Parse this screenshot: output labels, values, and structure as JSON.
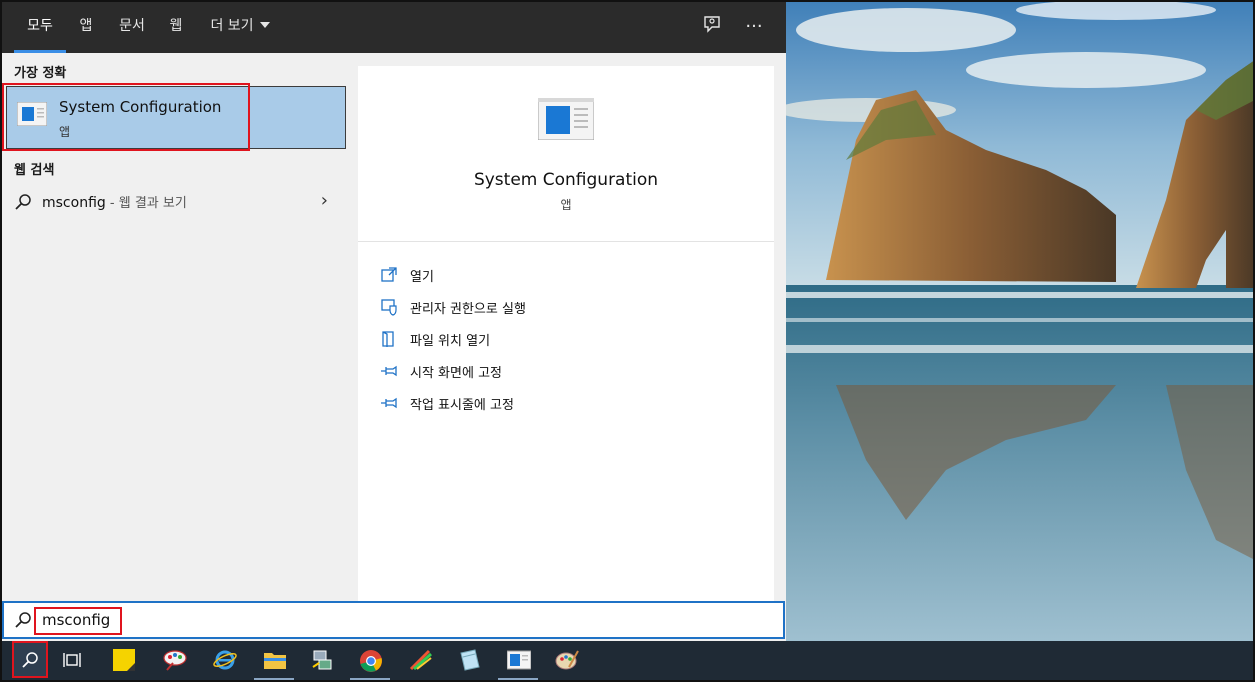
{
  "tabs": [
    {
      "label": "모두",
      "active": true
    },
    {
      "label": "앱"
    },
    {
      "label": "문서"
    },
    {
      "label": "웹"
    },
    {
      "label": "더 보기"
    }
  ],
  "topbar_icons": [
    "feedback-icon",
    "more-options-icon"
  ],
  "topbar_more_glyph": "···",
  "best_match": {
    "heading": "가장 정확",
    "title": "System Configuration",
    "subtitle": "앱"
  },
  "web_search": {
    "heading": "웹 검색",
    "query": "msconfig",
    "hint": " - 웹 결과 보기"
  },
  "detail": {
    "title": "System Configuration",
    "subtitle": "앱",
    "actions": [
      {
        "label": "열기",
        "icon": "open-icon"
      },
      {
        "label": "관리자 권한으로 실행",
        "icon": "run-as-admin-icon"
      },
      {
        "label": "파일 위치 열기",
        "icon": "file-location-icon"
      },
      {
        "label": "시작 화면에 고정",
        "icon": "pin-icon"
      },
      {
        "label": "작업 표시줄에 고정",
        "icon": "pin-icon"
      }
    ]
  },
  "search_box": {
    "value": "msconfig"
  },
  "taskbar": [
    "search-icon",
    "task-view-icon",
    "sticky-notes-icon",
    "paint-icon",
    "edge-icon",
    "file-explorer-icon",
    "network-icon",
    "chrome-icon",
    "pen-app-icon",
    "notebook-icon",
    "system-config-icon",
    "paint-palette-icon"
  ],
  "colors": {
    "accent": "#1f72c6",
    "highlight": "#a9cbe8",
    "annotation_red": "#e0141e",
    "topbar": "#2b2b2b",
    "taskbar": "#1f2a35"
  }
}
